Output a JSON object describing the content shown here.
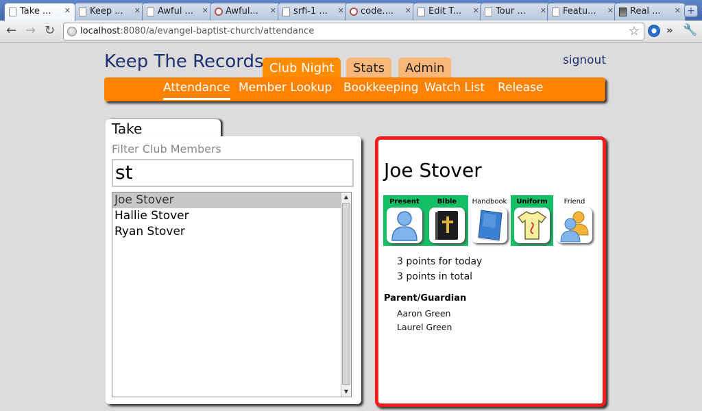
{
  "browser": {
    "tabs": [
      {
        "label": "Take ..."
      },
      {
        "label": "Keep ..."
      },
      {
        "label": "Awful ..."
      },
      {
        "label": "Awful..."
      },
      {
        "label": "srfi-1 ..."
      },
      {
        "label": "code...."
      },
      {
        "label": "Edit T..."
      },
      {
        "label": "Tour ..."
      },
      {
        "label": "Featu..."
      },
      {
        "label": "Real ..."
      }
    ],
    "url_host": "localhost",
    "url_rest": ":8080/a/evangel-baptist-church/attendance"
  },
  "app": {
    "title": "Keep The Records",
    "signout": "signout",
    "main_tabs": [
      {
        "label": "Club Night"
      },
      {
        "label": "Stats"
      },
      {
        "label": "Admin"
      }
    ],
    "subnav": [
      {
        "label": "Attendance"
      },
      {
        "label": "Member Lookup"
      },
      {
        "label": "Bookkeeping"
      },
      {
        "label": "Watch List"
      },
      {
        "label": "Release"
      }
    ]
  },
  "attendance": {
    "panel_title": "Take Attendance",
    "filter_label": "Filter Club Members",
    "filter_value": "st",
    "members": [
      {
        "name": "Joe Stover"
      },
      {
        "name": "Hallie Stover"
      },
      {
        "name": "Ryan Stover"
      }
    ]
  },
  "detail": {
    "name": "Joe Stover",
    "badges": [
      {
        "label": "Present",
        "earned": true,
        "icon": "person-icon"
      },
      {
        "label": "Bible",
        "earned": true,
        "icon": "bible-icon"
      },
      {
        "label": "Handbook",
        "earned": false,
        "icon": "handbook-icon"
      },
      {
        "label": "Uniform",
        "earned": true,
        "icon": "uniform-icon"
      },
      {
        "label": "Friend",
        "earned": false,
        "icon": "friends-icon"
      }
    ],
    "points_today": "3 points for today",
    "points_total": "3 points in total",
    "guardian_label": "Parent/Guardian",
    "guardians": [
      "Aaron Green",
      "Laurel Green"
    ]
  },
  "colors": {
    "accent": "#ff8200",
    "badge_earned": "#14bf66",
    "detail_border": "#f21c1c",
    "title": "#1d3070"
  }
}
